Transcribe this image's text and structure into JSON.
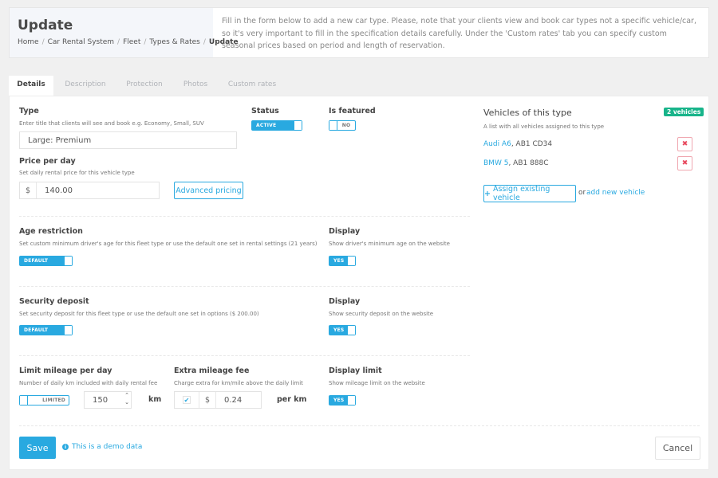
{
  "header": {
    "title": "Update",
    "breadcrumb": [
      "Home",
      "Car Rental System",
      "Fleet",
      "Types & Rates"
    ],
    "breadcrumb_current": "Update",
    "info": "Fill in the form below to add a new car type. Please, note that your clients view and book car types not a specific vehicle/car, so it's very important to fill in the specification details carefully. Under the 'Custom rates' tab you can specify custom seasonal prices based on period and length of reservation."
  },
  "tabs": [
    {
      "label": "Details",
      "active": true
    },
    {
      "label": "Description",
      "active": false
    },
    {
      "label": "Protection",
      "active": false
    },
    {
      "label": "Photos",
      "active": false
    },
    {
      "label": "Custom rates",
      "active": false
    }
  ],
  "form": {
    "type": {
      "label": "Type",
      "hint": "Enter title that clients will see and book e.g. Economy, Small, SUV",
      "value": "Large: Premium"
    },
    "status": {
      "label": "Status",
      "toggle": "ACTIVE",
      "on": true
    },
    "featured": {
      "label": "Is featured",
      "toggle": "NO",
      "on": false
    },
    "price": {
      "label": "Price per day",
      "hint": "Set daily rental price for this vehicle type",
      "currency": "$",
      "value": "140.00",
      "advanced_label": "Advanced pricing"
    },
    "age": {
      "label": "Age restriction",
      "hint": "Set custom minimum driver's age for this fleet type or use the default one set in rental settings (21 years)",
      "toggle": "DEFAULT",
      "on": true
    },
    "age_display": {
      "label": "Display",
      "hint": "Show driver's minimum age on the website",
      "toggle": "YES",
      "on": true
    },
    "deposit": {
      "label": "Security deposit",
      "hint": "Set security deposit for this fleet type or use the default one set in options ($ 200.00)",
      "toggle": "DEFAULT",
      "on": true
    },
    "deposit_display": {
      "label": "Display",
      "hint": "Show security deposit on the website",
      "toggle": "YES",
      "on": true
    },
    "mileage": {
      "label": "Limit mileage per day",
      "hint": "Number of daily km included with daily rental fee",
      "toggle": "LIMITED",
      "on": false,
      "value": "150",
      "unit": "km"
    },
    "extra_fee": {
      "label": "Extra mileage fee",
      "hint": "Charge extra for km/mile above the daily limit",
      "checked": true,
      "currency": "$",
      "value": "0.24",
      "unit": "per km"
    },
    "mileage_display": {
      "label": "Display limit",
      "hint": "Show mileage limit on the website",
      "toggle": "YES",
      "on": true
    }
  },
  "vehicles": {
    "title": "Vehicles of this type",
    "badge": "2 vehicles",
    "hint": "A list with all vehicles assigned to this type",
    "items": [
      {
        "name": "Audi A6",
        "plate": ", AB1 CD34"
      },
      {
        "name": "BMW 5",
        "plate": ", AB1 888C"
      }
    ],
    "assign_label": "Assign existing vehicle",
    "or_text": "or",
    "add_new_label": "add new vehicle"
  },
  "footer": {
    "save_label": "Save",
    "demo_text": "This is a demo data",
    "cancel_label": "Cancel"
  },
  "colors": {
    "accent": "#29a9e0",
    "success": "#18b48a",
    "danger": "#e84a5f"
  }
}
